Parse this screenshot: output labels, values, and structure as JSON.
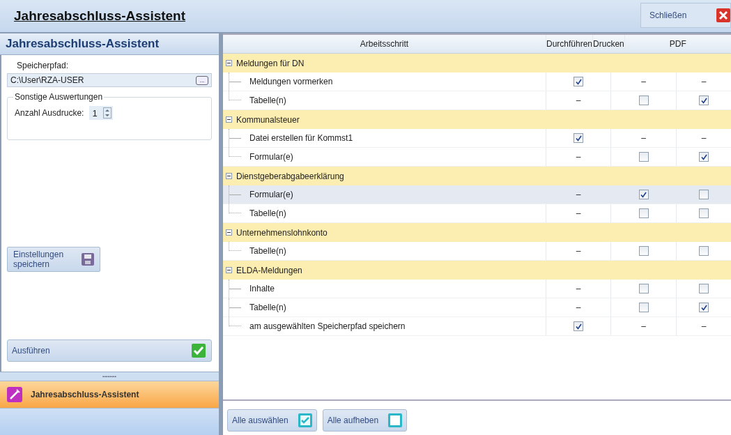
{
  "window": {
    "title": "Jahresabschluss-Assistent",
    "close_button": "Schließen"
  },
  "sidebar": {
    "title": "Jahresabschluss-Assistent",
    "path_label": "Speicherpfad:",
    "path_value": "C:\\User\\RZA-USER",
    "browse_button": "...",
    "group_title": "Sonstige Auswertungen",
    "copies_label": "Anzahl Ausdrucke:",
    "copies_value": "1",
    "save_button": "Einstellungen speichern",
    "run_button": "Ausführen",
    "splitter": "........",
    "nav_item": {
      "label": "Jahresabschluss-Assistent",
      "selected": true
    }
  },
  "table": {
    "columns": [
      "Arbeitsschritt",
      "Durchführen",
      "Drucken",
      "PDF"
    ],
    "groups": [
      {
        "label": "Meldungen für DN",
        "expanded": true,
        "rows": [
          {
            "label": "Meldungen vormerken",
            "selected": false,
            "cells": [
              {
                "kind": "checkbox",
                "checked": true
              },
              {
                "kind": "dash",
                "text": "–"
              },
              {
                "kind": "dash",
                "text": "–"
              }
            ]
          },
          {
            "label": "Tabelle(n)",
            "selected": false,
            "cells": [
              {
                "kind": "dash",
                "text": "–"
              },
              {
                "kind": "checkbox",
                "checked": false
              },
              {
                "kind": "checkbox",
                "checked": true
              }
            ]
          }
        ]
      },
      {
        "label": "Kommunalsteuer",
        "expanded": true,
        "rows": [
          {
            "label": "Datei erstellen für Kommst1",
            "selected": false,
            "cells": [
              {
                "kind": "checkbox",
                "checked": true
              },
              {
                "kind": "dash",
                "text": "–"
              },
              {
                "kind": "dash",
                "text": "–"
              }
            ]
          },
          {
            "label": "Formular(e)",
            "selected": false,
            "cells": [
              {
                "kind": "dash",
                "text": "–"
              },
              {
                "kind": "checkbox",
                "checked": false
              },
              {
                "kind": "checkbox",
                "checked": true
              }
            ]
          }
        ]
      },
      {
        "label": "Dienstgeberabgabeerklärung",
        "expanded": true,
        "rows": [
          {
            "label": "Formular(e)",
            "selected": true,
            "cells": [
              {
                "kind": "dash",
                "text": "–"
              },
              {
                "kind": "checkbox",
                "checked": true
              },
              {
                "kind": "checkbox",
                "checked": false
              }
            ]
          },
          {
            "label": "Tabelle(n)",
            "selected": false,
            "cells": [
              {
                "kind": "dash",
                "text": "–"
              },
              {
                "kind": "checkbox",
                "checked": false
              },
              {
                "kind": "checkbox",
                "checked": false
              }
            ]
          }
        ]
      },
      {
        "label": "Unternehmenslohnkonto",
        "expanded": true,
        "rows": [
          {
            "label": "Tabelle(n)",
            "selected": false,
            "cells": [
              {
                "kind": "dash",
                "text": "–"
              },
              {
                "kind": "checkbox",
                "checked": false
              },
              {
                "kind": "checkbox",
                "checked": false
              }
            ]
          }
        ]
      },
      {
        "label": "ELDA-Meldungen",
        "expanded": true,
        "rows": [
          {
            "label": "Inhalte",
            "selected": false,
            "cells": [
              {
                "kind": "dash",
                "text": "–"
              },
              {
                "kind": "checkbox",
                "checked": false
              },
              {
                "kind": "checkbox",
                "checked": false
              }
            ]
          },
          {
            "label": "Tabelle(n)",
            "selected": false,
            "cells": [
              {
                "kind": "dash",
                "text": "–"
              },
              {
                "kind": "checkbox",
                "checked": false
              },
              {
                "kind": "checkbox",
                "checked": true
              }
            ]
          },
          {
            "label": "am ausgewählten Speicherpfad speichern",
            "selected": false,
            "cells": [
              {
                "kind": "checkbox",
                "checked": true
              },
              {
                "kind": "dash",
                "text": "–"
              },
              {
                "kind": "dash",
                "text": "–"
              }
            ]
          }
        ]
      }
    ]
  },
  "buttons": [
    {
      "label": "Alle auswählen",
      "kind": "check"
    },
    {
      "label": "Alle aufheben",
      "kind": "clear"
    }
  ]
}
